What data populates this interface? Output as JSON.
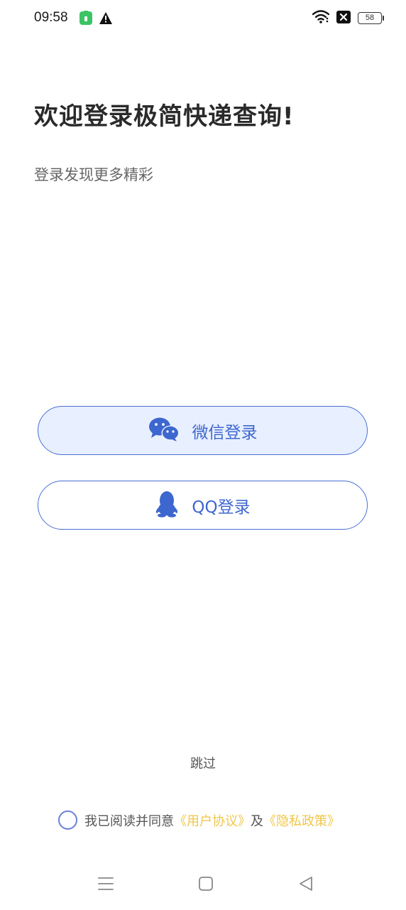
{
  "status_bar": {
    "time": "09:58",
    "battery": "58",
    "icons": [
      "app-notification-icon",
      "warning-icon",
      "wifi-icon",
      "sim-off-icon",
      "battery-icon"
    ]
  },
  "header": {
    "title": "欢迎登录极简快递查询!",
    "subtitle": "登录发现更多精彩"
  },
  "login": {
    "wechat_label": "微信登录",
    "qq_label": "QQ登录"
  },
  "skip_label": "跳过",
  "agreement": {
    "prefix": "我已阅读并同意",
    "user_agreement": "《用户协议》",
    "conjunction": "及",
    "privacy_policy": "《隐私政策》",
    "checked": false
  },
  "nav_bar": {
    "icons": [
      "menu-icon",
      "home-icon",
      "back-icon"
    ]
  },
  "colors": {
    "accent": "#3d66cf",
    "wechat_bg": "#e8efff",
    "link": "#f0c648"
  }
}
